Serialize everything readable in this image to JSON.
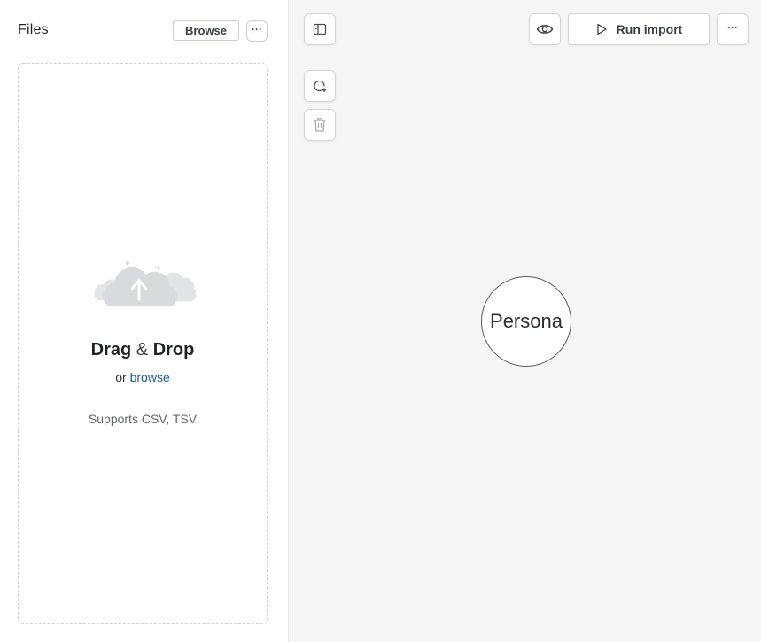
{
  "files_panel": {
    "title": "Files",
    "browse_label": "Browse",
    "more_label": "···",
    "dropzone": {
      "drag": "Drag",
      "amp": "&",
      "drop": "Drop",
      "or_text": "or ",
      "browse_link": "browse",
      "supports": "Supports CSV, TSV"
    }
  },
  "toolbar": {
    "toggle_panel_icon": "sidebar-toggle-icon",
    "preview_icon": "eye-icon",
    "run_label": "Run import",
    "run_icon": "play-icon",
    "more_label": "···"
  },
  "side_tools": {
    "add_node_icon": "add-circle-icon",
    "delete_icon": "trash-icon"
  },
  "canvas": {
    "node_label": "Persona"
  },
  "colors": {
    "canvas_bg": "#f4f5f4",
    "link": "#1e5b8c",
    "border": "#d3d6d5"
  }
}
